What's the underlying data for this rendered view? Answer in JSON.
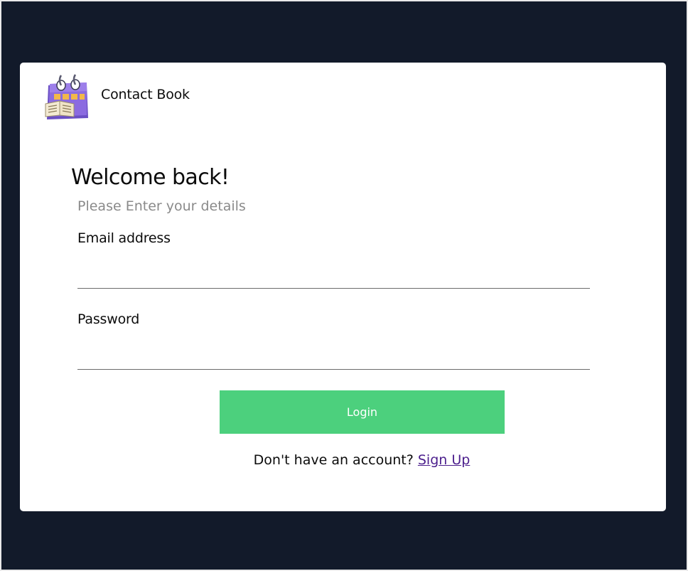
{
  "app": {
    "name": "Contact Book"
  },
  "login": {
    "title": "Welcome back!",
    "subtitle": "Please Enter your details",
    "email_label": "Email address",
    "email_value": "",
    "password_label": "Password",
    "password_value": "",
    "login_button": "Login",
    "signup_prompt": "Don't have an account?",
    "signup_link": "Sign Up"
  },
  "colors": {
    "background": "#121a2a",
    "card": "#ffffff",
    "button": "#4cd07d",
    "link": "#4b1e8c",
    "subtitle": "#8a8a8a"
  },
  "icons": {
    "logo": "calendar-book-icon"
  }
}
